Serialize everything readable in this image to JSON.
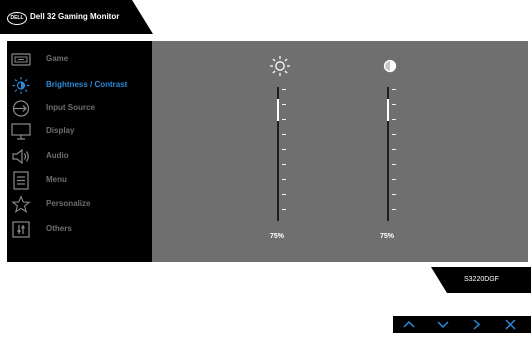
{
  "header": {
    "logo_text": "DELL",
    "title": "Dell 32 Gaming Monitor"
  },
  "menu": {
    "active_index": 1,
    "items": [
      {
        "label": "Game",
        "icon": "game-icon"
      },
      {
        "label": "Brightness / Contrast",
        "icon": "brightness-icon"
      },
      {
        "label": "Input Source",
        "icon": "input-source-icon"
      },
      {
        "label": "Display",
        "icon": "display-icon"
      },
      {
        "label": "Audio",
        "icon": "audio-icon"
      },
      {
        "label": "Menu",
        "icon": "menu-icon"
      },
      {
        "label": "Personalize",
        "icon": "personalize-icon"
      },
      {
        "label": "Others",
        "icon": "others-icon"
      }
    ]
  },
  "sliders": [
    {
      "name": "brightness",
      "icon": "sun-icon",
      "value_label": "75%",
      "value": 75
    },
    {
      "name": "contrast",
      "icon": "contrast-icon",
      "value_label": "75%",
      "value": 75
    }
  ],
  "model": "S3220DGF",
  "nav_buttons": [
    {
      "icon": "chevron-up-icon"
    },
    {
      "icon": "chevron-down-icon"
    },
    {
      "icon": "chevron-right-icon"
    },
    {
      "icon": "close-icon"
    }
  ],
  "colors": {
    "accent": "#2b8ad8",
    "panel": "#6f6f6f",
    "sidebar": "#000000",
    "inactive_text": "#6e6e6e"
  }
}
